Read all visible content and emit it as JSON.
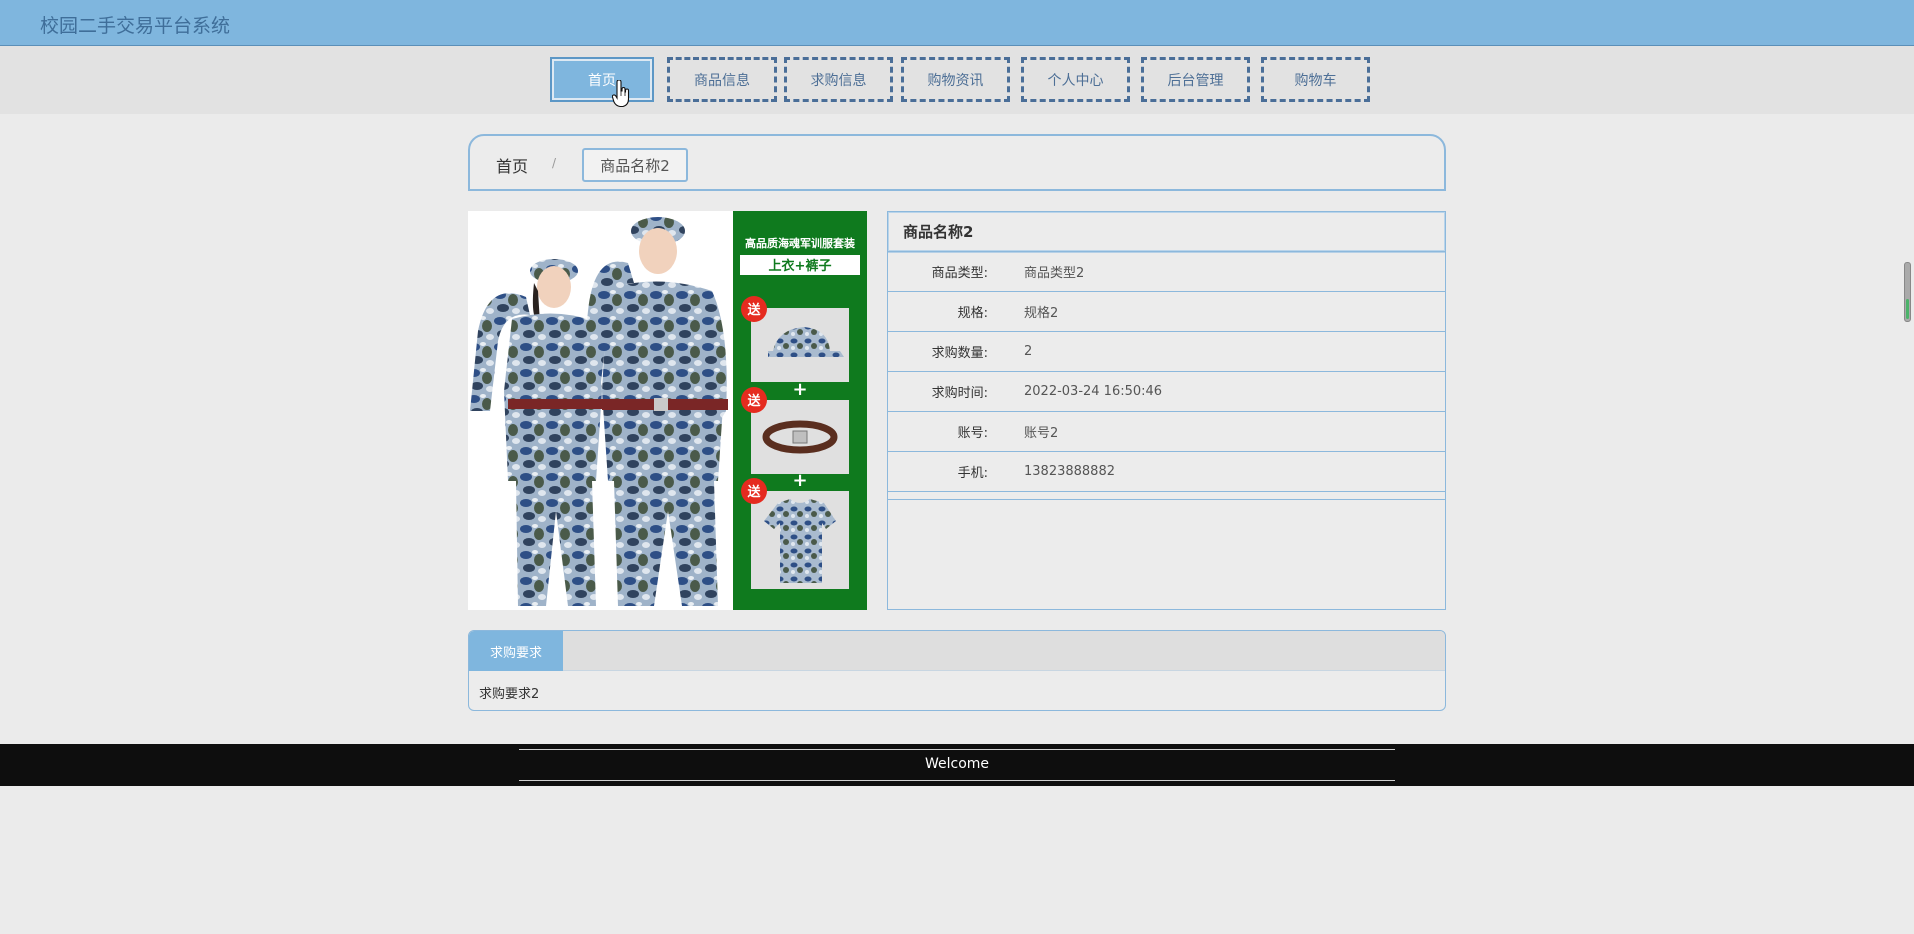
{
  "app": {
    "title": "校园二手交易平台系统"
  },
  "nav": [
    {
      "label": "首页",
      "active": true
    },
    {
      "label": "商品信息",
      "active": false
    },
    {
      "label": "求购信息",
      "active": false
    },
    {
      "label": "购物资讯",
      "active": false
    },
    {
      "label": "个人中心",
      "active": false
    },
    {
      "label": "后台管理",
      "active": false
    },
    {
      "label": "购物车",
      "active": false
    }
  ],
  "breadcrumb": {
    "home": "首页",
    "separator": "/",
    "current": "商品名称2"
  },
  "product_image": {
    "banner_line1": "高品质海魂军训服套装",
    "banner_line2": "上衣+裤子",
    "gift_badge": "送",
    "plus": "+"
  },
  "detail": {
    "title": "商品名称2",
    "rows": [
      {
        "label": "商品类型:",
        "value": "商品类型2"
      },
      {
        "label": "规格:",
        "value": "规格2"
      },
      {
        "label": "求购数量:",
        "value": "2"
      },
      {
        "label": "求购时间:",
        "value": "2022-03-24 16:50:46"
      },
      {
        "label": "账号:",
        "value": "账号2"
      },
      {
        "label": "手机:",
        "value": "13823888882"
      }
    ]
  },
  "requirements": {
    "tab_label": "求购要求",
    "content": "求购要求2"
  },
  "footer": {
    "text": "Welcome"
  },
  "colors": {
    "accent": "#7fb6de",
    "nav_border": "#4a6e98",
    "panel_border": "#8cb8dc",
    "footer_bg": "#0e0e0e",
    "banner_green": "#0f7a1e"
  }
}
